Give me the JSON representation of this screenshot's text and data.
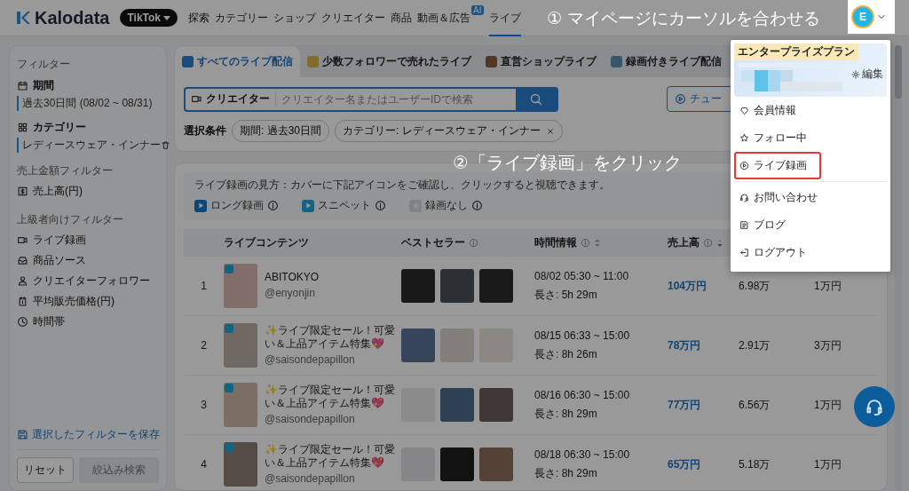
{
  "header": {
    "logo": "Kalodata",
    "platform": "TikTok",
    "nav": [
      {
        "label": "探索",
        "selected": false
      },
      {
        "label": "カテゴリー",
        "selected": false
      },
      {
        "label": "ショップ",
        "selected": false
      },
      {
        "label": "クリエイター",
        "selected": false
      },
      {
        "label": "商品",
        "selected": false
      },
      {
        "label": "動画＆広告",
        "selected": false,
        "badge": "AI"
      },
      {
        "label": "ライブ",
        "selected": true
      }
    ],
    "avatar": "E"
  },
  "annotations": [
    "① マイページにカーソルを合わせる",
    "②「ライブ録画」をクリック"
  ],
  "sidebar": {
    "title": "フィルター",
    "period": {
      "label": "期間",
      "value": "過去30日間 (08/02 ~ 08/31)"
    },
    "category": {
      "label": "カテゴリー",
      "value": "レディースウェア・インナー"
    },
    "groups": [
      {
        "heading": "売上金額フィルター",
        "items": [
          "売上高(円)"
        ]
      },
      {
        "heading": "上級者向けフィルター",
        "items": [
          "ライブ録画",
          "商品ソース",
          "クリエイターフォロワー",
          "平均販売価格(円)",
          "時間帯"
        ]
      }
    ],
    "save_link": "選択したフィルターを保存",
    "reset_button": "リセット",
    "apply_button": {
      "label": "絞込み検索",
      "disabled": true
    }
  },
  "tabs": [
    {
      "label": "すべてのライブ配信",
      "selected": true
    },
    {
      "label": "少数フォロワーで売れたライブ",
      "selected": false
    },
    {
      "label": "直営ショップライブ",
      "selected": false
    },
    {
      "label": "録画付きライブ配信",
      "selected": false
    }
  ],
  "search": {
    "scope": "クリエイター",
    "placeholder": "クリエイター名またはユーザーIDで検索"
  },
  "tutorial_button": "チュー",
  "conditions": {
    "label": "選択条件",
    "chips": [
      {
        "text": "期間: 過去30日間",
        "removable": false
      },
      {
        "text": "カテゴリー: レディースウェア・インナー",
        "removable": true
      }
    ]
  },
  "guide": "ライブ録画の見方：カバーに下記アイコンをご確認し、クリックすると視聴できます。",
  "legend": [
    {
      "kind": "long",
      "label": "ロング録画"
    },
    {
      "kind": "snippet",
      "label": "スニペット"
    },
    {
      "kind": "none",
      "label": "録画なし"
    }
  ],
  "table": {
    "columns": [
      {
        "label": "ライブコンテンツ"
      },
      {
        "label": "ベストセラー",
        "info": true
      },
      {
        "label": "時間情報",
        "info": true,
        "sorted": false
      },
      {
        "label": "売上高",
        "info": true,
        "sorted": true
      }
    ],
    "rows": [
      {
        "index": "1",
        "title": "ABITOKYO",
        "handle": "@enyonjin",
        "time": "08/02 05:30 ~ 11:00",
        "duration": "長さ: 5h 29m",
        "sales": "104万円",
        "column_6": "6.98万",
        "column_7": "1万円"
      },
      {
        "index": "2",
        "title": "✨ライブ限定セール！可愛い＆上品アイテム特集💖",
        "handle": "@saisondepapillon",
        "time": "08/15 06:33 ~ 15:00",
        "duration": "長さ: 8h 26m",
        "sales": "78万円",
        "column_6": "2.91万",
        "column_7": "3万円"
      },
      {
        "index": "3",
        "title": "✨ライブ限定セール！可愛い＆上品アイテム特集💖",
        "handle": "@saisondepapillon",
        "time": "08/16 06:30 ~ 15:00",
        "duration": "長さ: 8h 29m",
        "sales": "77万円",
        "column_6": "6.56万",
        "column_7": "1万円"
      },
      {
        "index": "4",
        "title": "✨ライブ限定セール！可愛い＆上品アイテム特集💖",
        "handle": "@saisondepapillon",
        "time": "08/18 06:30 ~ 15:00",
        "duration": "長さ: 8h 29m",
        "sales": "65万円",
        "column_6": "5.18万",
        "column_7": "1万円"
      }
    ]
  },
  "menu": {
    "plan": "エンタープライズプラン",
    "edit": "編集",
    "items": [
      {
        "label": "会員情報",
        "highlighted": false
      },
      {
        "label": "フォロー中",
        "highlighted": false
      },
      {
        "label": "ライブ録画",
        "highlighted": true
      },
      {
        "label": "お問い合わせ",
        "highlighted": false
      },
      {
        "label": "ブログ",
        "highlighted": false
      },
      {
        "label": "ログアウト",
        "highlighted": false
      }
    ]
  }
}
